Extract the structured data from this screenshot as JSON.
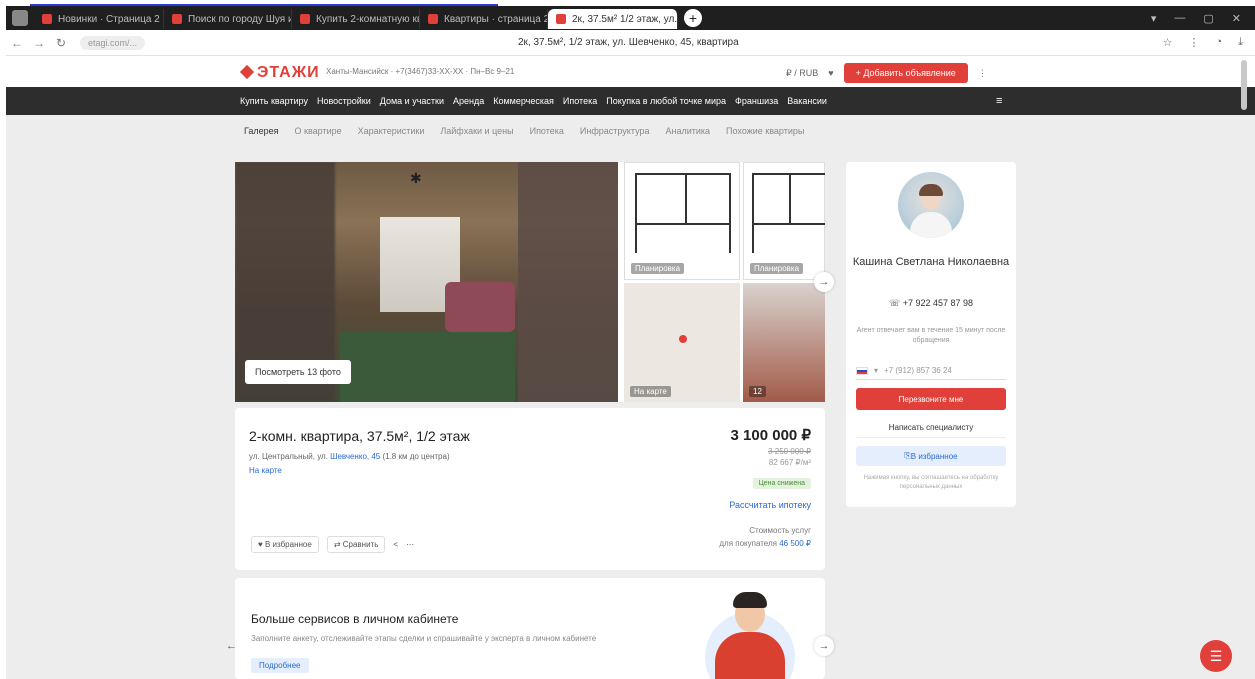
{
  "browser": {
    "tabs": [
      {
        "label": "Новинки · Страница 2",
        "active": false
      },
      {
        "label": "Поиск по городу Шуя и п...",
        "active": false
      },
      {
        "label": "Купить 2-комнатную кв...",
        "active": false
      },
      {
        "label": "Квартиры · страница 2",
        "active": false
      },
      {
        "label": "2к, 37.5м² 1/2 этаж, ул...",
        "active": true
      }
    ],
    "new_tab": "+",
    "address_short": "etagi.com/...",
    "page_title": "2к, 37.5м², 1/2 этаж, ул. Шевченко, 45, квартира"
  },
  "site": {
    "logo": "ЭТАЖИ",
    "city": "Ханты-Мансийск · +7(3467)33-XX-XX · Пн–Вс 9–21",
    "currency": "₽ / RUB",
    "add_button": "+ Добавить объявление",
    "nav": [
      "Купить квартиру",
      "Новостройки",
      "Дома и участки",
      "Аренда",
      "Коммерческая",
      "Ипотека",
      "Покупка в любой точке мира",
      "Франшиза",
      "Вакансии"
    ],
    "subnav": [
      "Галерея",
      "О квартире",
      "Характеристики",
      "Лайфхаки и цены",
      "Ипотека",
      "Инфраструктура",
      "Аналитика",
      "Похожие квартиры"
    ]
  },
  "gallery": {
    "view_photos": "Посмотреть 13 фото",
    "thumb_plan_1": "Планировка",
    "thumb_plan_2": "Планировка",
    "thumb_map": "На карте",
    "thumb_photo": "12"
  },
  "listing": {
    "title": "2-комн. квартира, 37.5м², 1/2 этаж",
    "address_prefix": "ул. Центральный, ул. ",
    "address_link": "Шевченко, 45",
    "address_suffix": " (1.8 км до центра)",
    "map_link": "На карте",
    "price": "3 100 000 ₽",
    "price_old": "3 250 000 ₽",
    "price_per_m": "82 667 ₽/м²",
    "badge": "Цена снижена",
    "mortgage_link": "Рассчитать ипотеку",
    "cost_label": "Стоимость услуг",
    "cost_for": "для покупателя ",
    "cost_value": "46 500 ₽",
    "actions": [
      "В избранное",
      "Сравнить",
      "<",
      "⋯"
    ]
  },
  "promo": {
    "title": "Больше сервисов в личном кабинете",
    "subtitle": "Заполните анкету, отслеживайте этапы сделки и спрашивайте у эксперта в личном кабинете",
    "button": "Подробнее"
  },
  "agent": {
    "name": "Кашина Светлана Николаевна",
    "phone": "+7 922 457 87 98",
    "note": "Агент отвечает вам в течение 15 минут после обращения",
    "phone_placeholder": "+7 (912) 857 36 24",
    "call_button": "Перезвоните мне",
    "write_button": "Написать специалисту",
    "fav_button": "В избранное",
    "footer": "Нажимая кнопку, вы соглашаетесь на обработку персональных данных"
  },
  "colors": {
    "brand": "#e1403a",
    "link": "#2a6ad6",
    "nav_bg": "#2d2d2d"
  }
}
